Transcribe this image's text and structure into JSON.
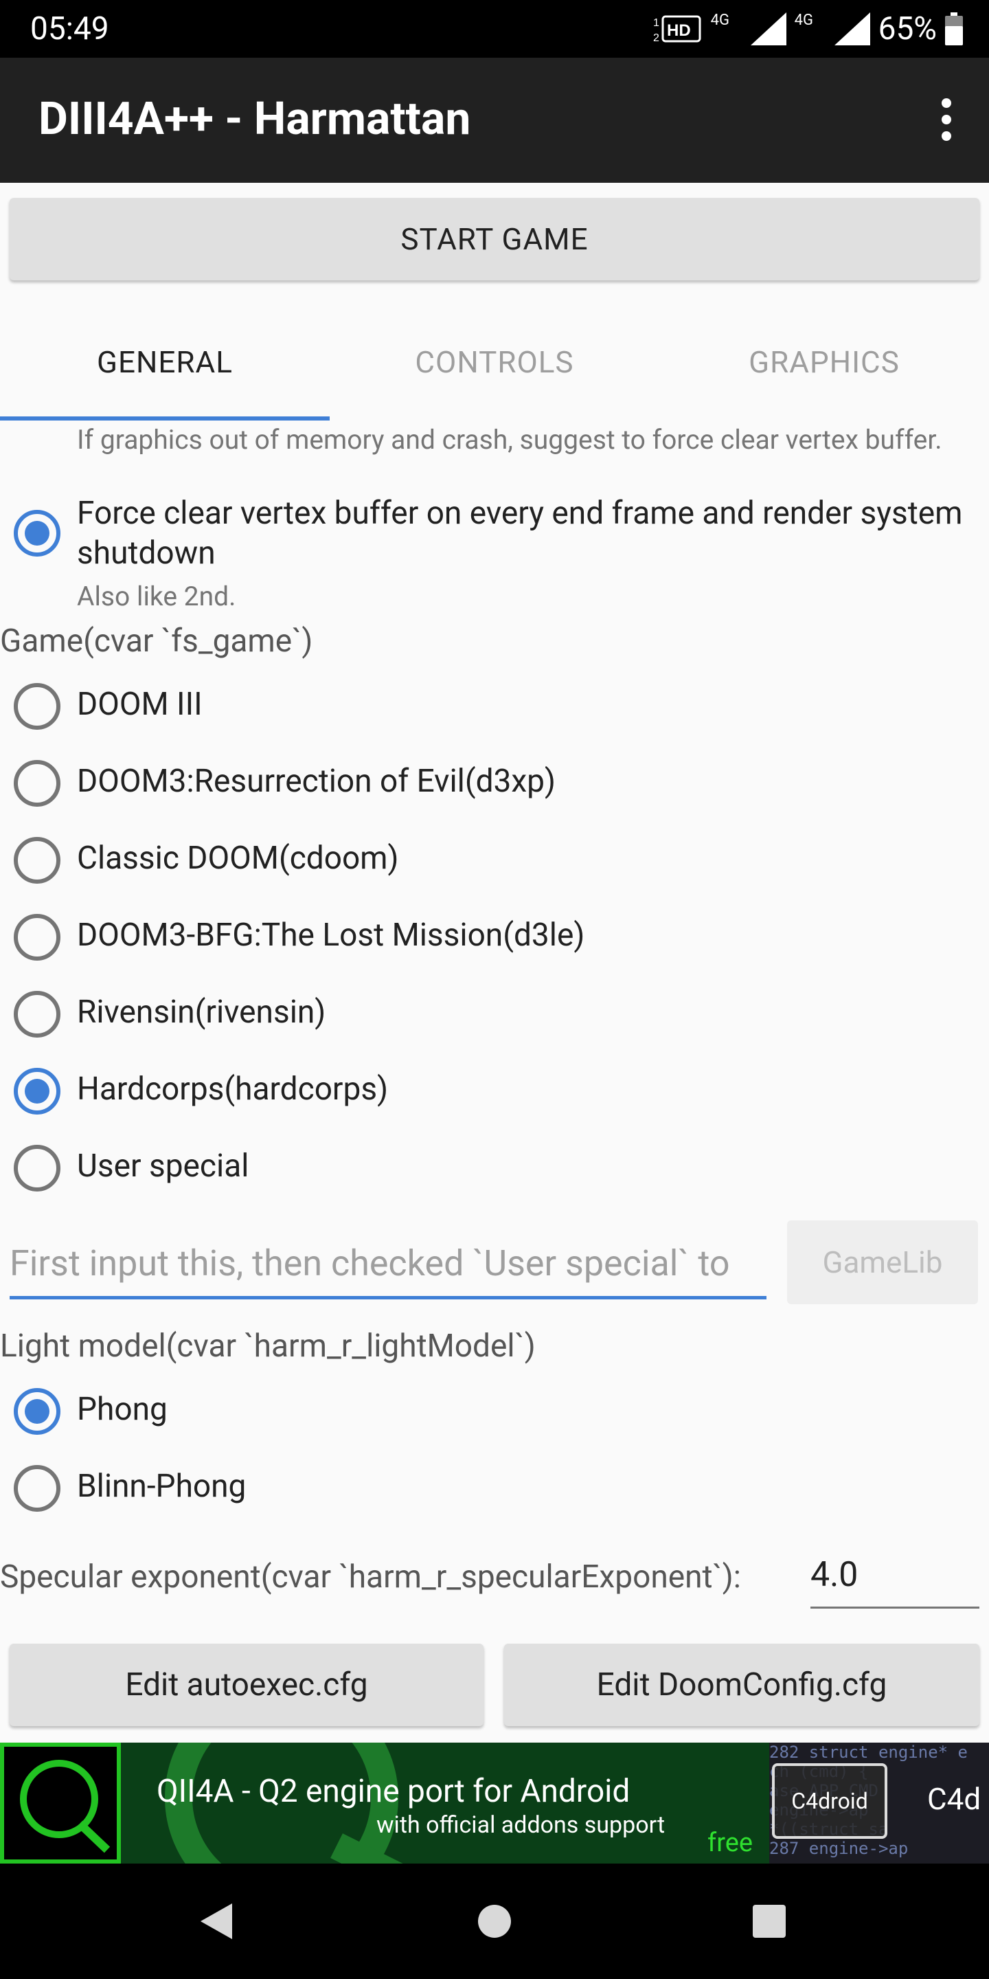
{
  "status_bar": {
    "time": "05:49",
    "network_1": "4G",
    "network_2": "4G",
    "battery_percent": "65%",
    "icons": [
      "hd-voice-icon",
      "signal-icon",
      "signal-icon",
      "battery-icon"
    ]
  },
  "app_bar": {
    "title": "DIII4A++ - Harmattan",
    "menu_icon": "overflow-menu-icon"
  },
  "start_button": {
    "label": "START GAME"
  },
  "tabs": [
    {
      "label": "GENERAL",
      "active": true
    },
    {
      "label": "CONTROLS",
      "active": false
    },
    {
      "label": "GRAPHICS",
      "active": false
    }
  ],
  "vertex_buffer": {
    "top_hint": "If graphics out of memory and crash, suggest to force clear vertex buffer.",
    "option_label": "Force clear vertex buffer on every end frame and render system shutdown",
    "option_checked": true,
    "option_hint": "Also like 2nd."
  },
  "game": {
    "section_label": "Game(cvar `fs_game`)",
    "options": [
      {
        "label": "DOOM III",
        "checked": false
      },
      {
        "label": "DOOM3:Resurrection of Evil(d3xp)",
        "checked": false
      },
      {
        "label": "Classic DOOM(cdoom)",
        "checked": false
      },
      {
        "label": "DOOM3-BFG:The Lost Mission(d3le)",
        "checked": false
      },
      {
        "label": "Rivensin(rivensin)",
        "checked": false
      },
      {
        "label": "Hardcorps(hardcorps)",
        "checked": true
      },
      {
        "label": "User special",
        "checked": false
      }
    ],
    "input_placeholder": "First input this, then checked `User special` to",
    "gamelib_button": "GameLib"
  },
  "light_model": {
    "section_label": "Light model(cvar `harm_r_lightModel`)",
    "options": [
      {
        "label": "Phong",
        "checked": true
      },
      {
        "label": "Blinn-Phong",
        "checked": false
      }
    ]
  },
  "specular": {
    "label": "Specular exponent(cvar `harm_r_specularExponent`):",
    "value": "4.0"
  },
  "config_buttons": {
    "autoexec": "Edit autoexec.cfg",
    "doomconfig": "Edit DoomConfig.cfg"
  },
  "ad": {
    "line1": "QII4A - Q2 engine port for Android",
    "line2": "with official addons support",
    "free": "free",
    "c4_icon": "C4droid",
    "c4_text": "C4d",
    "code_lines": [
      "282  struct engine* e",
      "     ch (cmd) {",
      "     ase APP_CMD",
      "     engine->ap",
      "     *((struct sa",
      "287  engine->ap"
    ]
  },
  "colors": {
    "accent": "#3f7fd6",
    "app_bar": "#212121",
    "background": "#fafafa",
    "ad_green": "#22c322"
  }
}
